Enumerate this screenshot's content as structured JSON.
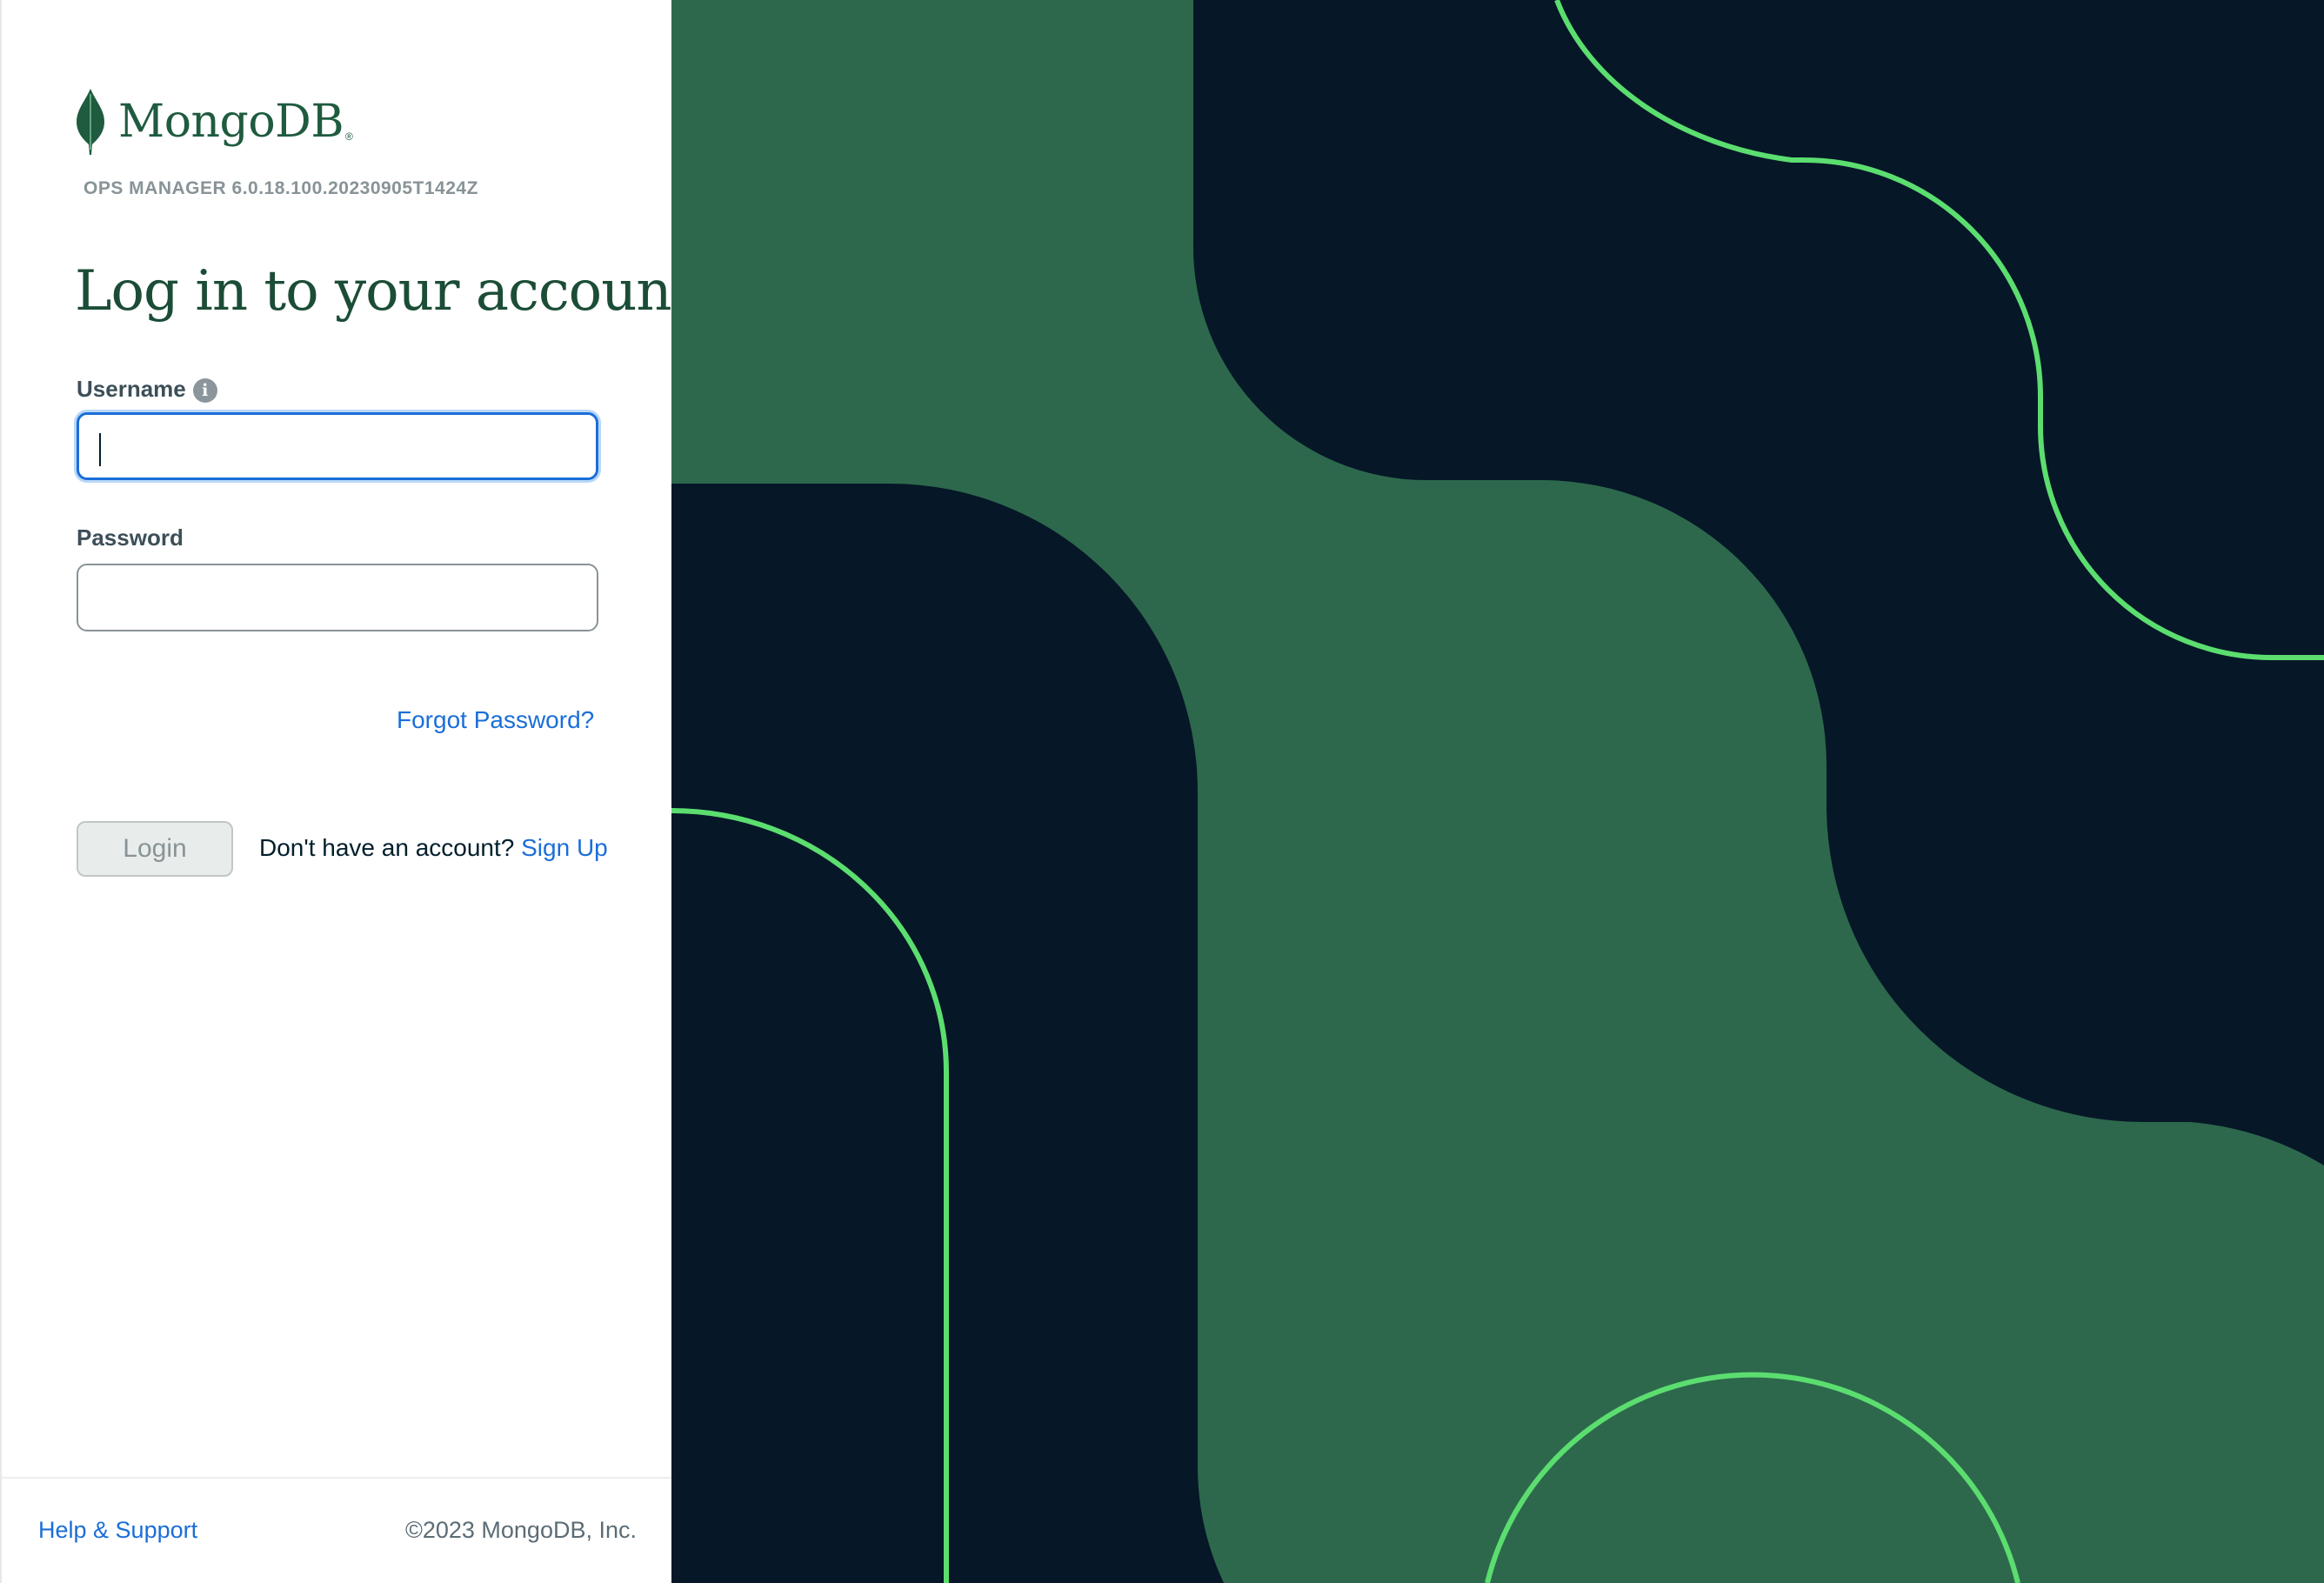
{
  "brand": {
    "name": "MongoDB",
    "registered_mark": "®",
    "version": "OPS MANAGER 6.0.18.100.20230905T1424Z"
  },
  "form": {
    "heading": "Log in to your account",
    "username_label": "Username",
    "username_value": "",
    "password_label": "Password",
    "password_value": "",
    "forgot_password": "Forgot Password?",
    "login_button": "Login",
    "no_account_text": "Don't have an account?",
    "signup_link": "Sign Up"
  },
  "footer": {
    "help": "Help & Support",
    "copyright": "©2023 MongoDB, Inc."
  },
  "colors": {
    "brand_green": "#1f5b3f",
    "link_blue": "#1a6ed8",
    "panel_dark": "#061727",
    "panel_green": "#2d684c",
    "accent_green": "#5bde6f"
  },
  "icons": {
    "logo": "mongodb-leaf-icon",
    "username_info": "info-icon"
  }
}
